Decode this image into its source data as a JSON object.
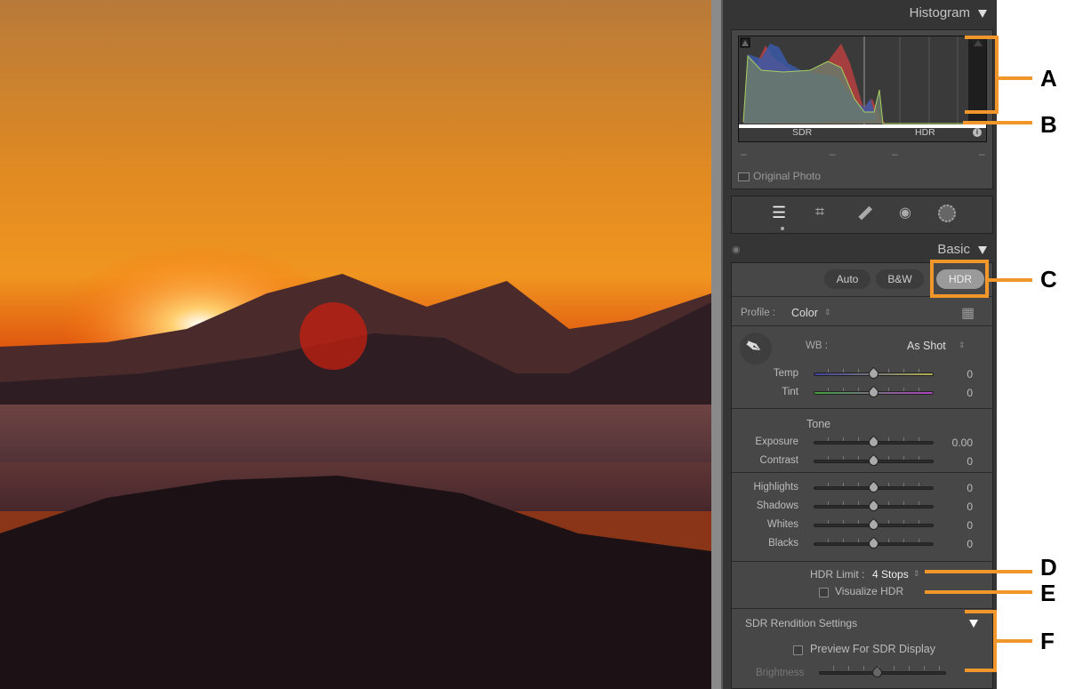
{
  "histogram": {
    "title": "Histogram",
    "sdr_label": "SDR",
    "hdr_label": "HDR",
    "readouts": [
      "–",
      "–",
      "–",
      "–"
    ],
    "original_photo_label": "Original Photo"
  },
  "tools": [
    "edit-sliders",
    "crop",
    "healing",
    "red-eye",
    "masking"
  ],
  "basic": {
    "title": "Basic",
    "buttons": {
      "auto": "Auto",
      "bw": "B&W",
      "hdr": "HDR"
    },
    "profile_label": "Profile :",
    "profile_value": "Color",
    "wb_label": "WB :",
    "wb_value": "As Shot",
    "tone_label": "Tone",
    "sliders": [
      {
        "label": "Temp",
        "value": "0",
        "position": 0.5
      },
      {
        "label": "Tint",
        "value": "0",
        "position": 0.5
      },
      {
        "label": "Exposure",
        "value": "0.00",
        "position": 0.5
      },
      {
        "label": "Contrast",
        "value": "0",
        "position": 0.5
      },
      {
        "label": "Highlights",
        "value": "0",
        "position": 0.5
      },
      {
        "label": "Shadows",
        "value": "0",
        "position": 0.5
      },
      {
        "label": "Whites",
        "value": "0",
        "position": 0.5
      },
      {
        "label": "Blacks",
        "value": "0",
        "position": 0.5
      }
    ],
    "hdr_limit_label": "HDR Limit :",
    "hdr_limit_value": "4 Stops",
    "visualize_hdr_label": "Visualize HDR",
    "sdr_rendition": {
      "title": "SDR Rendition Settings",
      "preview_label": "Preview For SDR Display",
      "brightness_label": "Brightness",
      "brightness_position": 0.58
    }
  },
  "annotations": [
    "A",
    "B",
    "C",
    "D",
    "E",
    "F"
  ],
  "colors": {
    "accent": "#f0962a",
    "panel": "#353535",
    "section": "#474747"
  }
}
